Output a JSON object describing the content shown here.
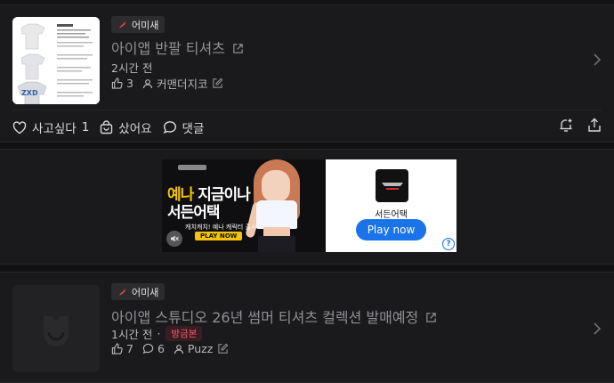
{
  "posts": [
    {
      "badge": "어미새",
      "title": "아이앱 반팔 티셔츠",
      "time": "2시간 전",
      "likes": "3",
      "author": "커맨더지코",
      "actions": {
        "want_label": "사고싶다",
        "want_count": "1",
        "bought_label": "샀어요",
        "comment_label": "댓글"
      }
    },
    {
      "badge": "어미새",
      "title": "아이앱 스튜디오 26년 썸머 티셔츠 컬렉션 발매예정",
      "time": "1시간 전",
      "hot_label": "방금본",
      "likes": "7",
      "comments": "6",
      "author": "Puzz"
    }
  ],
  "ad": {
    "headline_yellow": "예나",
    "headline_white1": "지금이나",
    "headline_white2": "서든어택",
    "subtext": "캐치캐치! 예나 캐릭터 출시",
    "play_tag": "PLAY NOW",
    "app_name": "서든어택",
    "cta": "Play now",
    "help": "?"
  },
  "colors": {
    "background": "#121212",
    "card": "#1a1a1c",
    "hot_badge": "#ef5b6e",
    "play_button": "#1a73e8",
    "ad_yellow": "#f5c400"
  },
  "icons": [
    "bird-icon",
    "external-link-icon",
    "thumbs-up-icon",
    "user-icon",
    "edit-icon",
    "chevron-right-icon",
    "heart-icon",
    "shopping-bag-icon",
    "comment-icon",
    "bell-plus-icon",
    "share-icon",
    "mute-icon"
  ]
}
